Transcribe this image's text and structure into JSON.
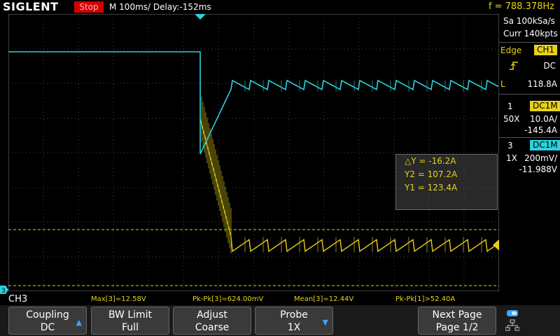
{
  "header": {
    "brand": "SIGLENT",
    "run_state": "Stop",
    "timebase": "M 100ms/  Delay:-152ms",
    "frequency": "f = 788.378Hz"
  },
  "right_panel": {
    "sample_rate": "Sa 100kSa/s",
    "memory": "Curr 140kpts",
    "trigger": {
      "type": "Edge",
      "source": "CH1",
      "coupling": "DC",
      "slope_level_label": "L",
      "level": "118.8A"
    },
    "ch1": {
      "number": "1",
      "coupling": "DC1M",
      "probe": "50X",
      "scale": "10.0A/",
      "offset": "-145.4A"
    },
    "ch3": {
      "number": "3",
      "coupling": "DC1M",
      "probe": "1X",
      "scale": "200mV/",
      "offset": "-11.988V"
    }
  },
  "cursor_box": {
    "delta_y": "△Y = -16.2A",
    "y2": "Y2 = 107.2A",
    "y1": "Y1 = 123.4A"
  },
  "status": {
    "channel": "CH3",
    "max": "Max[3]=12.58V",
    "pkpk3": "Pk-Pk[3]=624.00mV",
    "mean": "Mean[3]=12.44V",
    "pkpk1": "Pk-Pk[1]>52.40A"
  },
  "menu": {
    "coupling_label": "Coupling",
    "coupling_value": "DC",
    "bw_label": "BW Limit",
    "bw_value": "Full",
    "adjust_label": "Adjust",
    "adjust_value": "Coarse",
    "probe_label": "Probe",
    "probe_value": "1X",
    "next_label": "Next Page",
    "next_value": "Page 1/2"
  },
  "colors": {
    "ch1": "#2ad3e0",
    "ch3": "#e6d11b",
    "stop": "#d00000"
  }
}
